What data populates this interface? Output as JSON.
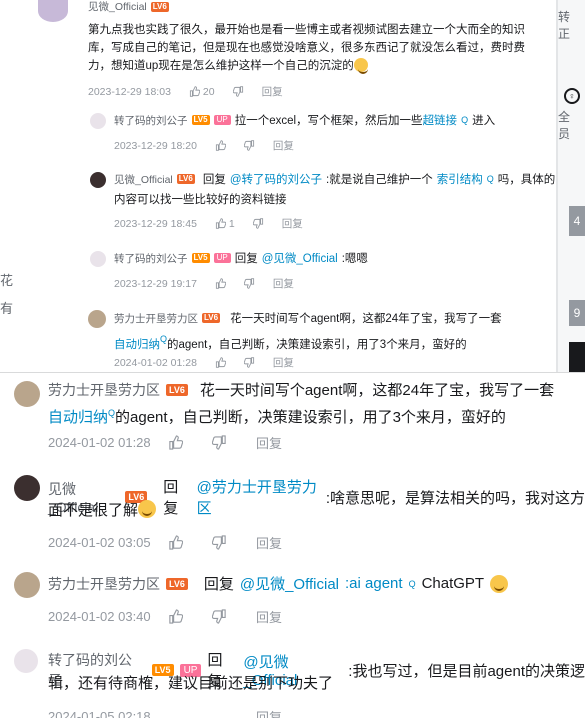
{
  "top": {
    "right_strip": {
      "label_top": "转正",
      "label_mid": "全员",
      "block1": "4",
      "block2": "9"
    },
    "left_bits": [
      "花",
      "有"
    ],
    "comments": [
      {
        "user": "见微_Official",
        "lv": "LV6",
        "text1": "第九点我也实践了很久，最开始也是看一些博主或者视频试图去建立一个大而全的知识",
        "text2": "库，写成自己的笔记，但是现在也感觉没啥意义，很多东西记了就没怎么看过，费时费",
        "text3": "力，想知道up现在是怎么维护这样一个自己的沉淀的",
        "time": "2023-12-29 18:03",
        "likes": "20",
        "reply": "回复"
      },
      {
        "user": "转了码的刘公子",
        "lv": "LV5",
        "up": "UP",
        "text_a": "拉一个excel，写个框架，然后加一些",
        "link": "超链接",
        "text_b": "进入",
        "time": "2023-12-29 18:20",
        "reply": "回复"
      },
      {
        "user": "见微_Official",
        "lv": "LV6",
        "reply_word": "回复",
        "mention": "@转了码的刘公子",
        "text_a": " :就是说自己维护一个",
        "link": "索引结构",
        "text_b": "吗，具体的",
        "text2": "内容可以找一些比较好的资料链接",
        "time": "2023-12-29 18:45",
        "likes": "1",
        "reply": "回复"
      },
      {
        "user": "转了码的刘公子",
        "lv": "LV5",
        "up": "UP",
        "reply_word": "回复",
        "mention": "@见微_Official",
        "text_a": " :嗯嗯",
        "time": "2023-12-29 19:17",
        "reply": "回复"
      },
      {
        "user": "劳力士开垦劳力区",
        "lv": "LV6",
        "text1": "花一天时间写个agent啊，这都24年了宝，我写了一套",
        "link": "自动归纳",
        "text2": "的agent，自己判断，决策建设索引，用了3个来月，蛮好的",
        "time": "2024-01-02 01:28",
        "reply": "回复"
      }
    ]
  },
  "main": {
    "comments": [
      {
        "user": "劳力士开垦劳力区",
        "lv": "LV6",
        "text1": "花一天时间写个agent啊，这都24年了宝，我写了一套",
        "link": "自动归纳",
        "text2": "的agent，自己判断，决策建设索引，用了3个来月，蛮好的",
        "time": "2024-01-02 01:28",
        "reply": "回复"
      },
      {
        "user": "见微_Official",
        "lv": "LV6",
        "reply_word": "回复",
        "mention": "@劳力士开垦劳力区",
        "text_a": " :啥意思呢，是算法相关的吗，我对这方",
        "text2": "面不是很了解",
        "time": "2024-01-02 03:05",
        "reply": "回复"
      },
      {
        "user": "劳力士开垦劳力区",
        "lv": "LV6",
        "reply_word": "回复",
        "mention": "@见微_Official",
        "text_a": " :ai agent",
        "text_b": " ChatGPT",
        "time": "2024-01-02 03:40",
        "reply": "回复"
      },
      {
        "user": "转了码的刘公子",
        "lv": "LV5",
        "up": "UP",
        "reply_word": "回复",
        "mention": "@见微_Official",
        "text_a": " :我也写过，但是目前agent的决策逻",
        "text2": "辑，还有待商榷，建议目前还是别下功夫了",
        "time": "2024-01-05 02:18",
        "reply": "回复"
      }
    ]
  },
  "colors": {
    "link": "#008ac5",
    "muted": "#9499a0",
    "name": "#61666d",
    "up_tag": "#fb7299",
    "lv6": "#ee672a"
  }
}
